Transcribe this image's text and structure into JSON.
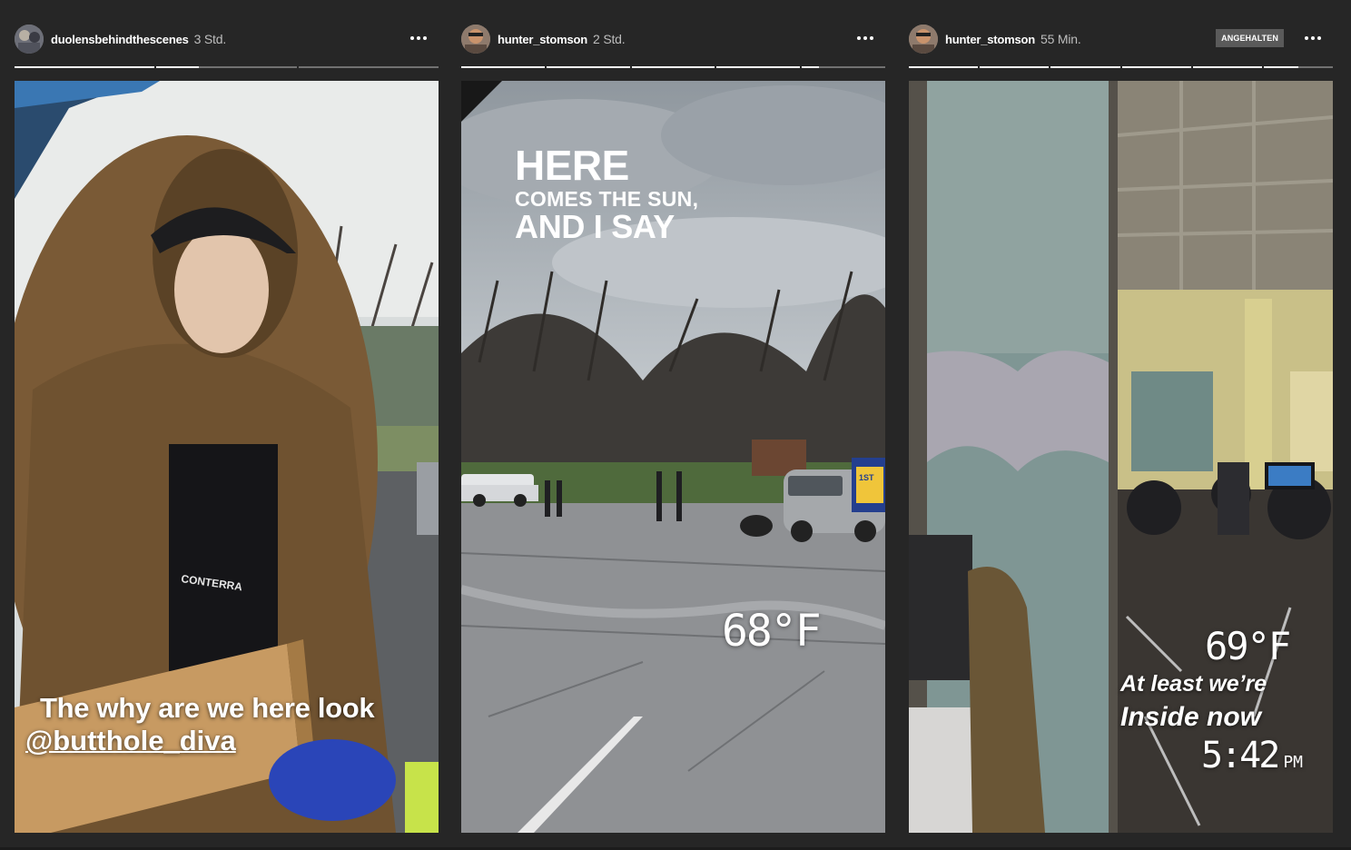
{
  "stories": [
    {
      "username": "duolensbehindthescenes",
      "time": "3 Std.",
      "progress_fill": [
        1,
        0.3,
        0
      ],
      "caption": "The why are we here look",
      "mention": "@butthole_diva"
    },
    {
      "username": "hunter_stomson",
      "time": "2 Std.",
      "progress_fill": [
        1,
        1,
        1,
        1,
        0.2
      ],
      "sticker_line1": "HERE",
      "sticker_line2": "COMES THE SUN,",
      "sticker_line3": "AND I SAY",
      "temperature": "68°F"
    },
    {
      "username": "hunter_stomson",
      "time": "55 Min.",
      "paused_label": "ANGEHALTEN",
      "progress_fill": [
        1,
        1,
        1,
        1,
        1,
        0.5
      ],
      "temperature": "69°F",
      "text1": "At least we’re",
      "text2": "Inside now",
      "clock_time": "5:42",
      "clock_ampm": "PM"
    }
  ],
  "icons": {
    "more": "more-horizontal-icon"
  }
}
